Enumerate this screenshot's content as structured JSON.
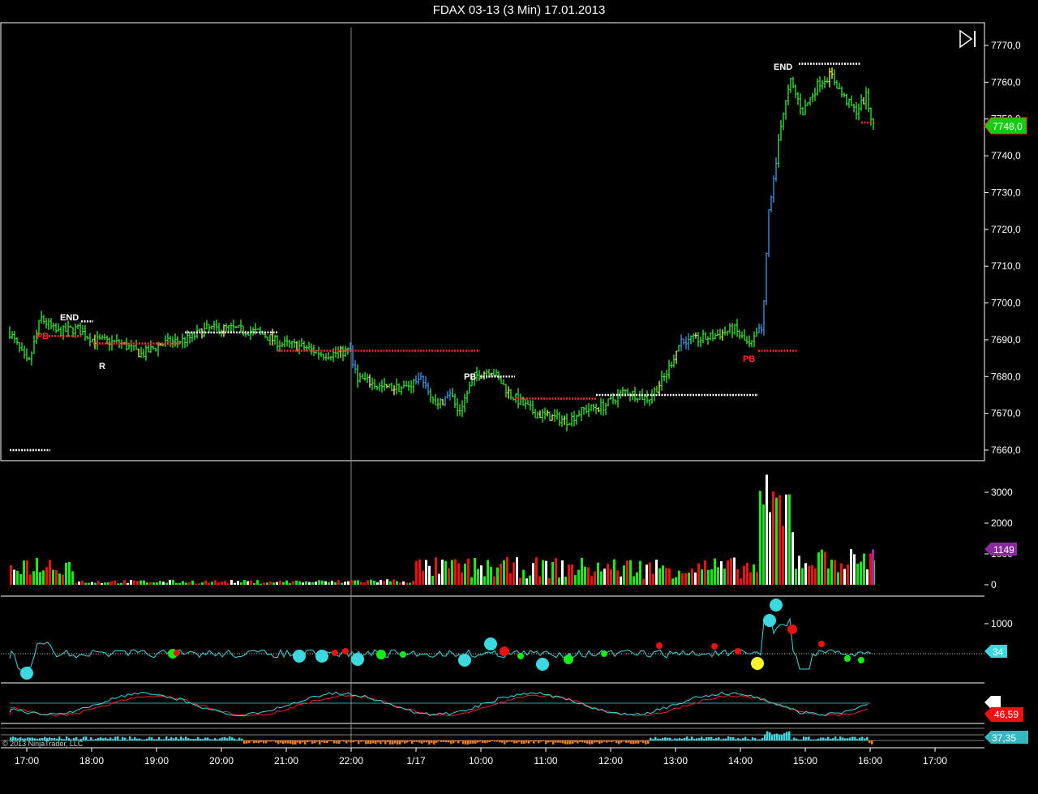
{
  "window": {
    "title": "FDAX 03-13 (3 Min)  17.01.2013"
  },
  "colors": {
    "background": "#000000",
    "bar_up": "#33dd33",
    "bar_down": "#3a8fdc",
    "bar_neutral": "#e8e84a",
    "level_white": "#ffffff",
    "level_red": "#ff2a2a",
    "vol_green": "#11ee11",
    "vol_red": "#ee1111",
    "vol_white": "#ffffff",
    "cyan": "#3cd8e0",
    "orange": "#ff7a10",
    "purple": "#9a2aa8"
  },
  "toolbar": {
    "play_icon": "skip-to-end-icon"
  },
  "chart_data": [
    {
      "type": "ohlc",
      "panel": "price",
      "ylim": [
        7655,
        7773
      ],
      "yticks": [
        "7770,0",
        "7760,0",
        "7750,0",
        "7740,0",
        "7730,0",
        "7720,0",
        "7710,0",
        "7700,0",
        "7690,0",
        "7680,0",
        "7670,0",
        "7660,0"
      ],
      "last_price_label": "7748,0",
      "last_price": 7748,
      "series": [
        {
          "segment": "17:00-18:30",
          "values": [
            7690,
            7684,
            7683,
            7689,
            7694,
            7698,
            7695,
            7692
          ]
        },
        {
          "segment": "18:30-20:00",
          "values": [
            7692,
            7690,
            7689,
            7687,
            7686,
            7688,
            7689,
            7690,
            7690
          ]
        },
        {
          "segment": "20:00-21:00",
          "values": [
            7691,
            7693,
            7694,
            7693,
            7693,
            7692,
            7691,
            7690
          ]
        },
        {
          "segment": "21:00-22:00",
          "values": [
            7690,
            7689,
            7688,
            7688,
            7687,
            7686,
            7686,
            7687
          ]
        },
        {
          "segment": "22:00-23:00",
          "values": [
            7680,
            7678,
            7678,
            7677,
            7676,
            7677,
            7676
          ]
        },
        {
          "segment": "1/17 09:00-10:30",
          "values": [
            7680,
            7675,
            7672,
            7670,
            7676,
            7678,
            7680,
            7677
          ]
        },
        {
          "segment": "10:30-12:00",
          "values": [
            7676,
            7673,
            7671,
            7670,
            7669,
            7668,
            7670
          ]
        },
        {
          "segment": "12:00-13:00",
          "values": [
            7670,
            7672,
            7673,
            7674,
            7675,
            7676,
            7679
          ]
        },
        {
          "segment": "13:00-14:30",
          "values": [
            7684,
            7688,
            7690,
            7691,
            7692,
            7693,
            7688
          ]
        },
        {
          "segment": "14:30-15:00",
          "values": [
            7700,
            7720,
            7738,
            7745,
            7752,
            7760
          ]
        },
        {
          "segment": "15:00-16:00",
          "values": [
            7755,
            7752,
            7758,
            7762,
            7760,
            7756,
            7752,
            7757,
            7748
          ]
        }
      ],
      "annotations": [
        {
          "text": "END",
          "price": 7695,
          "time": "17:30",
          "color": "#ffffff"
        },
        {
          "text": "PB",
          "price": 7691,
          "time": "17:10",
          "color": "#ff2a2a"
        },
        {
          "text": "R",
          "price": 7683,
          "time": "18:08",
          "color": "#ffffff"
        },
        {
          "text": "PB",
          "price": 7680,
          "time": "09:45",
          "color": "#ffffff"
        },
        {
          "text": "PB",
          "price": 7687,
          "time": "14:05",
          "color": "#ff2a2a"
        },
        {
          "text": "END",
          "price": 7765,
          "time": "14:25",
          "color": "#ffffff"
        }
      ]
    },
    {
      "type": "bar",
      "panel": "volume",
      "ylim": [
        0,
        3800
      ],
      "yticks": [
        "3000",
        "2000",
        "1000",
        "0"
      ],
      "last_value_label": "1149",
      "last_value": 1149
    },
    {
      "type": "line",
      "panel": "oscillator",
      "yticks": [
        "1000"
      ],
      "last_value_label": "34",
      "last_value": 34
    },
    {
      "type": "line",
      "panel": "stochastic",
      "labels": [
        "0",
        "46,59"
      ]
    },
    {
      "type": "bar",
      "panel": "histogram",
      "last_value_label": "37,35",
      "last_value": 37.35
    }
  ],
  "xaxis": {
    "ticks": [
      "17:00",
      "18:00",
      "19:00",
      "20:00",
      "21:00",
      "22:00",
      "1/17",
      "10:00",
      "11:00",
      "12:00",
      "13:00",
      "14:00",
      "15:00",
      "16:00",
      "17:00"
    ]
  },
  "footer": {
    "copyright": "© 2013 NinjaTrader, LLC"
  }
}
